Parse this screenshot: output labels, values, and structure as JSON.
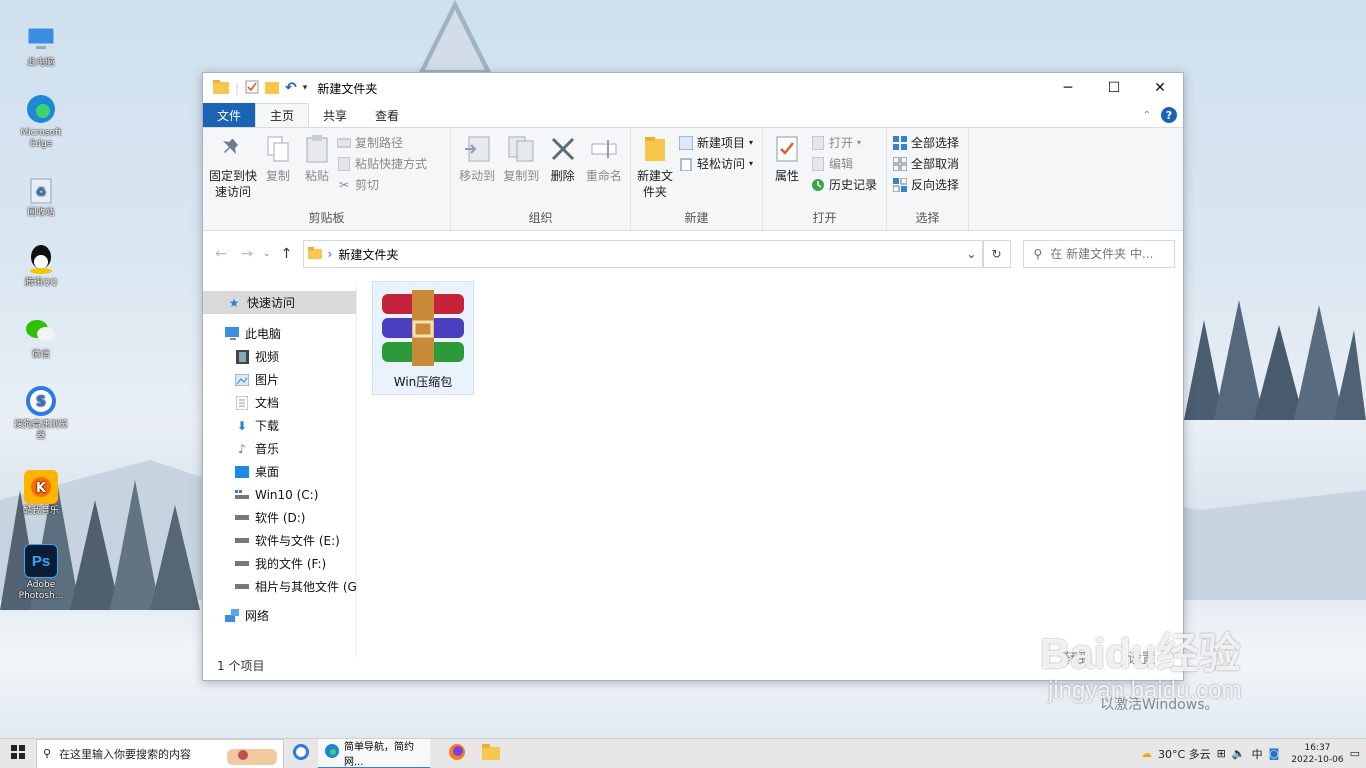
{
  "desktop": {
    "icons": [
      {
        "label": "此电脑",
        "icon": "computer-icon"
      },
      {
        "label": "Microsoft Edge",
        "icon": "edge-icon"
      },
      {
        "label": "回收站",
        "icon": "recycle-bin-icon"
      },
      {
        "label": "腾讯QQ",
        "icon": "qq-icon"
      },
      {
        "label": "微信",
        "icon": "wechat-icon"
      },
      {
        "label": "搜狗高速浏览器",
        "icon": "sogou-browser-icon"
      },
      {
        "label": "酷我音乐",
        "icon": "kuwo-music-icon"
      },
      {
        "label": "Adobe Photosh...",
        "icon": "photoshop-icon"
      }
    ]
  },
  "window": {
    "title": "新建文件夹",
    "tabs": {
      "file": "文件",
      "home": "主页",
      "share": "共享",
      "view": "查看"
    },
    "ribbon": {
      "clipboard": {
        "label": "剪贴板",
        "pin": "固定到快速访问",
        "copy": "复制",
        "paste": "粘贴",
        "copy_path": "复制路径",
        "paste_shortcut": "粘贴快捷方式",
        "cut": "剪切"
      },
      "organize": {
        "label": "组织",
        "move_to": "移动到",
        "copy_to": "复制到",
        "delete": "删除",
        "rename": "重命名"
      },
      "new": {
        "label": "新建",
        "new_folder": "新建文件夹",
        "new_item": "新建项目",
        "easy_access": "轻松访问"
      },
      "open": {
        "label": "打开",
        "properties": "属性",
        "open": "打开",
        "edit": "编辑",
        "history": "历史记录"
      },
      "select": {
        "label": "选择",
        "select_all": "全部选择",
        "select_none": "全部取消",
        "invert": "反向选择"
      }
    },
    "address": {
      "path": "新建文件夹",
      "search_placeholder": "在 新建文件夹 中..."
    },
    "nav": {
      "quick_access": "快速访问",
      "this_pc": "此电脑",
      "items": [
        {
          "label": "视频",
          "icon": "video-icon"
        },
        {
          "label": "图片",
          "icon": "pictures-icon"
        },
        {
          "label": "文档",
          "icon": "documents-icon"
        },
        {
          "label": "下载",
          "icon": "download-icon"
        },
        {
          "label": "音乐",
          "icon": "music-icon"
        },
        {
          "label": "桌面",
          "icon": "desktop-icon"
        },
        {
          "label": "Win10 (C:)",
          "icon": "system-drive-icon"
        },
        {
          "label": "软件 (D:)",
          "icon": "drive-icon"
        },
        {
          "label": "软件与文件 (E:)",
          "icon": "drive-icon"
        },
        {
          "label": "我的文件 (F:)",
          "icon": "drive-icon"
        },
        {
          "label": "相片与其他文件 (G:",
          "icon": "drive-icon"
        }
      ],
      "network": "网络"
    },
    "files": [
      {
        "name": "Win压缩包",
        "icon": "winrar-archive-icon"
      }
    ],
    "status": "1 个项目"
  },
  "watermark": {
    "brand": "Baidu",
    "brand_suffix": "经验",
    "site": "jingyan.baidu.com",
    "activate_line1": "转到",
    "activate_line2": "设置",
    "activate_line3": "以激活Windows。"
  },
  "taskbar": {
    "search_placeholder": "在这里输入你要搜索的内容",
    "edge_title": "简单导航，简约网...",
    "weather": "30°C 多云",
    "ime": "中",
    "time": "16:37",
    "date": "2022-10-06"
  },
  "colors": {
    "accent": "#1a63b5",
    "ribbon_bg": "#f5f6f7",
    "selection": "#eaf3fb"
  }
}
